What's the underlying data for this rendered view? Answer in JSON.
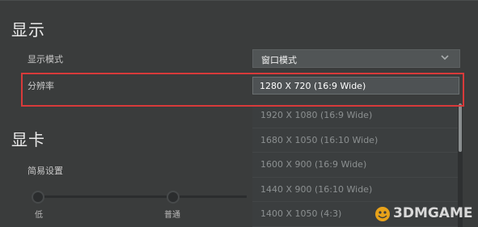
{
  "display_section": {
    "title": "显示",
    "mode": {
      "label": "显示模式",
      "value": "窗口模式"
    },
    "resolution": {
      "label": "分辨率",
      "value": "1280 X 720 (16:9 Wide)",
      "options": [
        "1920 X 1080 (16:9 Wide)",
        "1680 X 1050 (16:10 Wide)",
        "1600 X 900 (16:9 Wide)",
        "1440 X 900 (16:10 Wide)",
        "1400 X 1050 (4:3)"
      ]
    }
  },
  "gpu_section": {
    "title": "显卡",
    "easy_setting_label": "简易设置",
    "levels": [
      "低",
      "普通"
    ]
  },
  "watermark": "3DMGAME",
  "colors": {
    "highlight": "#d83a3a",
    "background": "#3a3c3c"
  }
}
